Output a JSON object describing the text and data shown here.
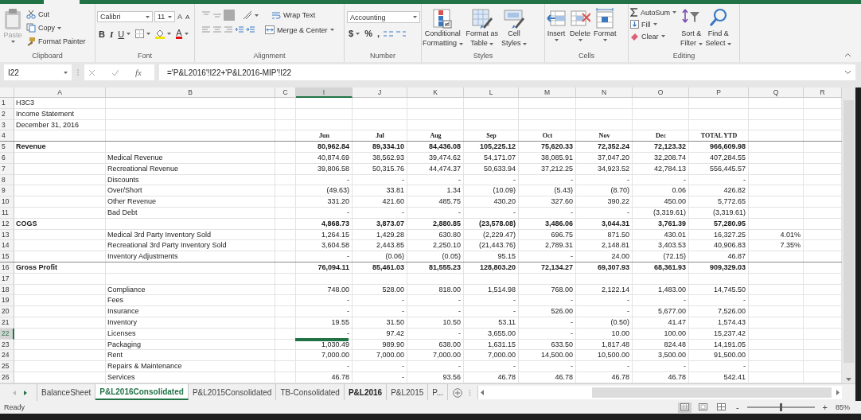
{
  "ribbon": {
    "clipboard": {
      "label": "Clipboard",
      "paste": {
        "label": "Paste",
        "disabled": true
      },
      "cut": "Cut",
      "copy": "Copy",
      "format_painter": "Format Painter"
    },
    "font": {
      "label": "Font",
      "name": "Calibri",
      "size": "11",
      "grow": "A",
      "shrink": "A",
      "bold": "B",
      "italic": "I",
      "underline": "U",
      "font_color": "A"
    },
    "alignment": {
      "label": "Alignment",
      "wrap_text": "Wrap Text",
      "merge": "Merge & Center"
    },
    "number": {
      "label": "Number",
      "format": "Accounting",
      "currency": "$",
      "percent": "%",
      "comma": ","
    },
    "styles": {
      "label": "Styles",
      "buttons": [
        {
          "kind": "conditional",
          "lines": [
            "Conditional",
            "Formatting"
          ]
        },
        {
          "kind": "table",
          "lines": [
            "Format as",
            "Table"
          ]
        },
        {
          "kind": "cell_styles",
          "lines": [
            "Cell",
            "Styles"
          ]
        }
      ]
    },
    "cells": {
      "label": "Cells",
      "buttons": [
        {
          "kind": "insert",
          "label": "Insert"
        },
        {
          "kind": "delete",
          "label": "Delete"
        },
        {
          "kind": "format",
          "label": "Format"
        }
      ]
    },
    "editing": {
      "label": "Editing",
      "autosum": "AutoSum",
      "fill": "Fill",
      "clear": "Clear",
      "buttons": [
        {
          "kind": "sort",
          "lines": [
            "Sort &",
            "Filter"
          ]
        },
        {
          "kind": "find",
          "lines": [
            "Find &",
            "Select"
          ]
        }
      ]
    }
  },
  "formula_bar": {
    "name_box": "I22",
    "fx": "fx",
    "formula": "='P&L2016'!I22+'P&L2016-MIP'!I22"
  },
  "sheet": {
    "columns": [
      {
        "label": "A",
        "selected": false
      },
      {
        "label": "B",
        "selected": false
      },
      {
        "label": "C",
        "selected": false
      },
      {
        "label": "I",
        "selected": true
      },
      {
        "label": "J",
        "selected": false
      },
      {
        "label": "K",
        "selected": false
      },
      {
        "label": "L",
        "selected": false
      },
      {
        "label": "M",
        "selected": false
      },
      {
        "label": "N",
        "selected": false
      },
      {
        "label": "O",
        "selected": false
      },
      {
        "label": "P",
        "selected": false
      },
      {
        "label": "Q",
        "selected": false
      },
      {
        "label": "R",
        "selected": false
      }
    ],
    "rows": [
      {
        "num": "1",
        "kind": "data",
        "selected": false,
        "bold": false,
        "rule_below": false,
        "label": "H3C3"
      },
      {
        "num": "2",
        "kind": "data",
        "selected": false,
        "bold": false,
        "rule_below": false,
        "label": "Income Statement"
      },
      {
        "num": "3",
        "kind": "data",
        "selected": false,
        "bold": false,
        "rule_below": false,
        "label": "December 31, 2016"
      },
      {
        "num": "4",
        "kind": "header",
        "selected": false,
        "bold": true,
        "rule_below": true,
        "values": [
          "Jun",
          "Jul",
          "Aug",
          "Sep",
          "Oct",
          "Nov",
          "Dec",
          "TOTAL YTD"
        ]
      },
      {
        "num": "5",
        "kind": "data",
        "selected": false,
        "bold": true,
        "rule_below": false,
        "label": "Revenue",
        "values": [
          "80,962.84",
          "89,334.10",
          "84,436.08",
          "105,225.12",
          "75,620.33",
          "72,352.24",
          "72,123.32",
          "966,609.98"
        ]
      },
      {
        "num": "6",
        "kind": "data",
        "selected": false,
        "bold": false,
        "rule_below": false,
        "item": "Medical Revenue",
        "values": [
          "40,874.69",
          "38,562.93",
          "39,474.62",
          "54,171.07",
          "38,085.91",
          "37,047.20",
          "32,208.74",
          "407,284.55"
        ]
      },
      {
        "num": "7",
        "kind": "data",
        "selected": false,
        "bold": false,
        "rule_below": false,
        "item": "Recreational Revenue",
        "values": [
          "39,806.58",
          "50,315.76",
          "44,474.37",
          "50,633.94",
          "37,212.25",
          "34,923.52",
          "42,784.13",
          "556,445.57"
        ]
      },
      {
        "num": "8",
        "kind": "data",
        "selected": false,
        "bold": false,
        "rule_below": false,
        "item": "Discounts",
        "values": [
          "-",
          "-",
          "-",
          "-",
          "-",
          "-",
          "-",
          "-"
        ]
      },
      {
        "num": "9",
        "kind": "data",
        "selected": false,
        "bold": false,
        "rule_below": false,
        "item": "Over/Short",
        "values": [
          "(49.63)",
          "33.81",
          "1.34",
          "(10.09)",
          "(5.43)",
          "(8.70)",
          "0.06",
          "426.82"
        ]
      },
      {
        "num": "10",
        "kind": "data",
        "selected": false,
        "bold": false,
        "rule_below": false,
        "item": "Other Revenue",
        "values": [
          "331.20",
          "421.60",
          "485.75",
          "430.20",
          "327.60",
          "390.22",
          "450.00",
          "5,772.65"
        ]
      },
      {
        "num": "11",
        "kind": "data",
        "selected": false,
        "bold": false,
        "rule_below": false,
        "item": "Bad Debt",
        "values": [
          "-",
          "-",
          "-",
          "-",
          "-",
          "-",
          "(3,319.61)",
          "(3,319.61)"
        ]
      },
      {
        "num": "12",
        "kind": "data",
        "selected": false,
        "bold": true,
        "rule_below": false,
        "label": "COGS",
        "values": [
          "4,868.73",
          "3,873.07",
          "2,880.85",
          "(23,578.08)",
          "3,486.06",
          "3,044.31",
          "3,761.39",
          "57,280.95"
        ]
      },
      {
        "num": "13",
        "kind": "data",
        "selected": false,
        "bold": false,
        "rule_below": false,
        "item": "Medical 3rd Party Inventory Sold",
        "values": [
          "1,264.15",
          "1,429.28",
          "630.80",
          "(2,229.47)",
          "696.75",
          "871.50",
          "430.01",
          "16,327.25"
        ],
        "note": "4.01%"
      },
      {
        "num": "14",
        "kind": "data",
        "selected": false,
        "bold": false,
        "rule_below": false,
        "item": "Recreational 3rd Party Inventory Sold",
        "values": [
          "3,604.58",
          "2,443.85",
          "2,250.10",
          "(21,443.76)",
          "2,789.31",
          "2,148.81",
          "3,403.53",
          "40,906.83"
        ],
        "note": "7.35%"
      },
      {
        "num": "15",
        "kind": "data",
        "selected": false,
        "bold": false,
        "rule_below": true,
        "item": "Inventory Adjustments",
        "values": [
          "-",
          "(0.06)",
          "(0.05)",
          "95.15",
          "-",
          "24.00",
          "(72.15)",
          "46.87"
        ]
      },
      {
        "num": "16",
        "kind": "data",
        "selected": false,
        "bold": true,
        "rule_below": false,
        "label": "Gross Profit",
        "values": [
          "76,094.11",
          "85,461.03",
          "81,555.23",
          "128,803.20",
          "72,134.27",
          "69,307.93",
          "68,361.93",
          "909,329.03"
        ]
      },
      {
        "num": "17",
        "kind": "data",
        "selected": false,
        "rule_below": false
      },
      {
        "num": "18",
        "kind": "data",
        "selected": false,
        "bold": false,
        "rule_below": false,
        "item": "Compliance",
        "values": [
          "748.00",
          "528.00",
          "818.00",
          "1,514.98",
          "768.00",
          "2,122.14",
          "1,483.00",
          "14,745.50"
        ]
      },
      {
        "num": "19",
        "kind": "data",
        "selected": false,
        "bold": false,
        "rule_below": false,
        "item": "Fees",
        "values": [
          "-",
          "-",
          "-",
          "-",
          "-",
          "-",
          "-",
          "-"
        ]
      },
      {
        "num": "20",
        "kind": "data",
        "selected": false,
        "bold": false,
        "rule_below": false,
        "item": "Insurance",
        "values": [
          "-",
          "-",
          "-",
          "-",
          "526.00",
          "-",
          "5,677.00",
          "7,526.00"
        ]
      },
      {
        "num": "21",
        "kind": "data",
        "selected": false,
        "bold": false,
        "rule_below": false,
        "item": "Inventory",
        "values": [
          "19.55",
          "31.50",
          "10.50",
          "53.11",
          "-",
          "(0.50)",
          "41.47",
          "1,574.43"
        ]
      },
      {
        "num": "22",
        "kind": "data",
        "selected": true,
        "bold": false,
        "rule_below": false,
        "item": "Licenses",
        "values": [
          "-",
          "97.42",
          "-",
          "3,655.00",
          "-",
          "10.00",
          "100.00",
          "15,237.42"
        ]
      },
      {
        "num": "23",
        "kind": "data",
        "selected": false,
        "bold": false,
        "rule_below": false,
        "item": "Packaging",
        "values": [
          "1,030.49",
          "989.90",
          "638.00",
          "1,631.15",
          "633.50",
          "1,817.48",
          "824.48",
          "14,191.05"
        ]
      },
      {
        "num": "24",
        "kind": "data",
        "selected": false,
        "bold": false,
        "rule_below": false,
        "item": "Rent",
        "values": [
          "7,000.00",
          "7,000.00",
          "7,000.00",
          "7,000.00",
          "14,500.00",
          "10,500.00",
          "3,500.00",
          "91,500.00"
        ]
      },
      {
        "num": "25",
        "kind": "data",
        "selected": false,
        "bold": false,
        "rule_below": false,
        "item": "Repairs & Maintenance",
        "values": [
          "-",
          "-",
          "-",
          "-",
          "-",
          "-",
          "-",
          "-"
        ]
      },
      {
        "num": "26",
        "kind": "data",
        "selected": false,
        "bold": false,
        "rule_below": false,
        "item": "Services",
        "values": [
          "46.78",
          "-",
          "93.56",
          "46.78",
          "46.78",
          "46.78",
          "46.78",
          "542.41"
        ]
      }
    ]
  },
  "sheet_tabs": {
    "tabs": [
      {
        "label": "BalanceSheet",
        "selected": false,
        "bold": false
      },
      {
        "label": "P&L2016Consolidated",
        "selected": true,
        "bold": true
      },
      {
        "label": "P&L2015Consolidated",
        "selected": false,
        "bold": false
      },
      {
        "label": "TB-Consolidated",
        "selected": false,
        "bold": false
      },
      {
        "label": "P&L2016",
        "selected": false,
        "bold": true
      },
      {
        "label": "P&L2015",
        "selected": false,
        "bold": false
      },
      {
        "label": "P...",
        "selected": false,
        "bold": false
      }
    ]
  },
  "status_bar": {
    "text": "Ready",
    "zoom_out": "-",
    "zoom_in": "+",
    "zoom": "85%",
    "level": 0.5
  }
}
